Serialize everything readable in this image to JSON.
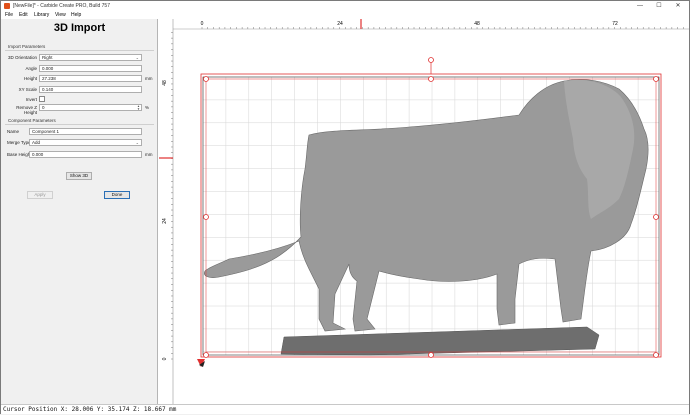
{
  "window": {
    "title": "[NewFile]* - Carbide Create PRO, Build 757",
    "controls": [
      "—",
      "☐",
      "✕"
    ]
  },
  "menu": [
    "File",
    "Edit",
    "Library",
    "View",
    "Help"
  ],
  "panel": {
    "title": "3D Import",
    "import_section": "Import Parameters",
    "orientation_label": "3D Orientation",
    "orientation_value": "Right",
    "angle_label": "Angle",
    "angle_value": "0.000",
    "height_label": "Height",
    "height_value": "27.238",
    "height_unit": "mm",
    "xy_scale_label": "XY Scale",
    "xy_scale_value": "0.140",
    "invert_label": "Invert",
    "remove_z_label": "Remove Z Height",
    "remove_z_value": "0",
    "remove_z_unit": "%",
    "component_section": "Component Parameters",
    "name_label": "Name",
    "name_value": "Component 1",
    "merge_label": "Merge Type",
    "merge_value": "Add",
    "base_height_label": "Base Height",
    "base_height_value": "0.000",
    "base_height_unit": "mm",
    "show3d_button": "Show 3D",
    "apply_button": "Apply",
    "done_button": "Done"
  },
  "ruler": {
    "top_labels": [
      "0",
      "24",
      "48",
      "72"
    ],
    "left_labels": [
      "48",
      "24",
      "0"
    ]
  },
  "colors": {
    "selection": "#e03030",
    "grid": "#d6d6d6",
    "model": "#9a9a9a",
    "base": "#6e6e6e"
  },
  "status": {
    "text": "Cursor Position X: 28.006 Y: 35.174 Z: 18.667 mm"
  }
}
